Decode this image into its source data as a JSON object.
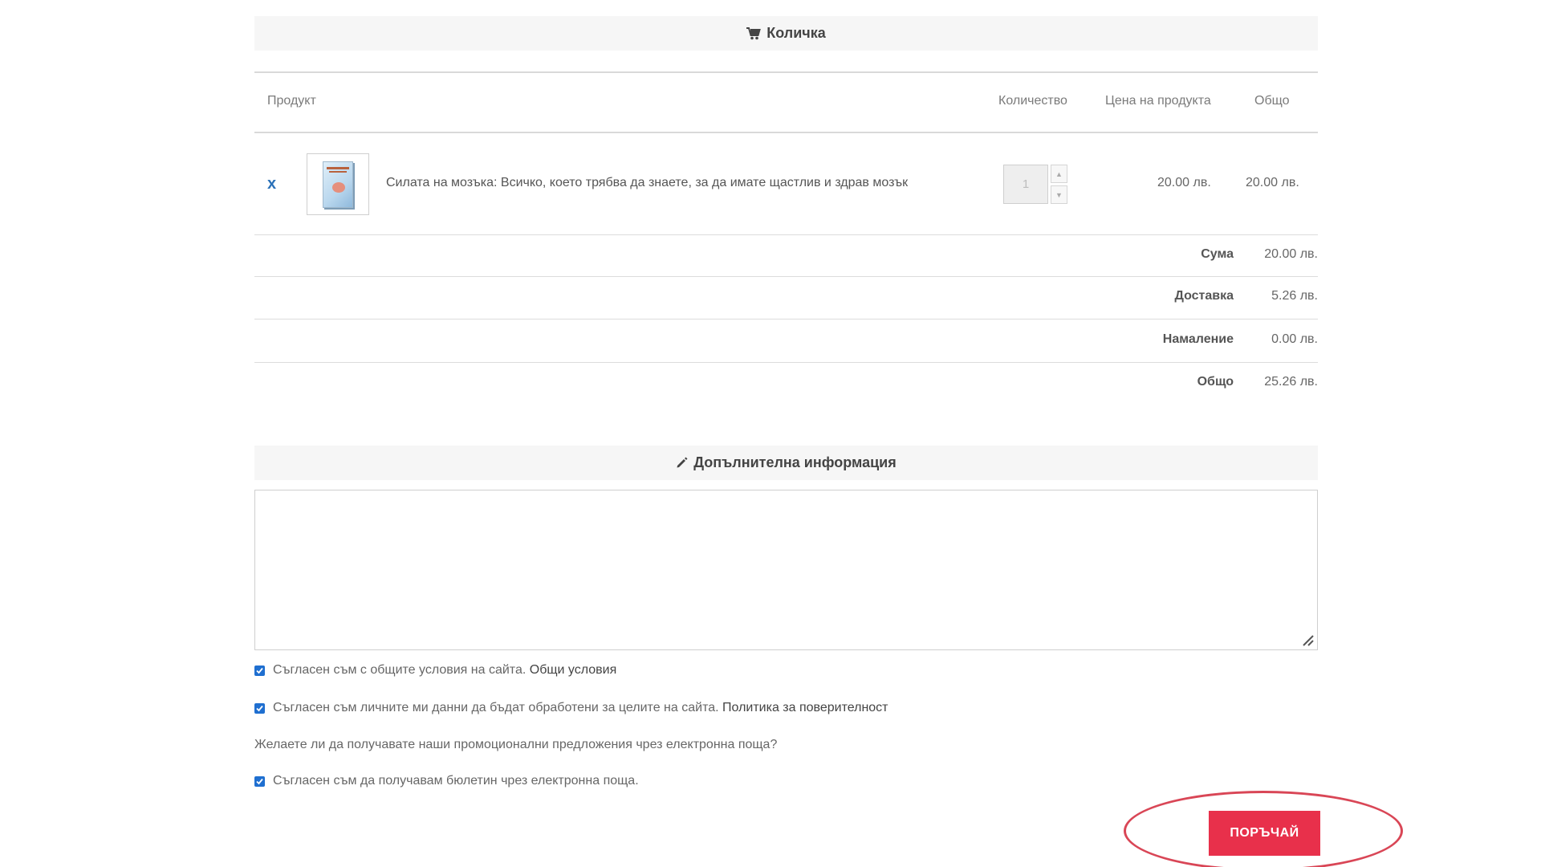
{
  "cart": {
    "title": "Количка",
    "columns": {
      "product": "Продукт",
      "quantity": "Количество",
      "price": "Цена на продукта",
      "total": "Общо"
    },
    "items": [
      {
        "remove_label": "x",
        "name": "Силата на мозъка: Всичко, което трябва да знаете, за да имате щастлив и здрав мозък",
        "quantity": "1",
        "price": "20.00 лв.",
        "total": "20.00 лв."
      }
    ],
    "summary": {
      "subtotal_label": "Сума",
      "subtotal_value": "20.00 лв.",
      "shipping_label": "Доставка",
      "shipping_value": "5.26 лв.",
      "discount_label": "Намаление",
      "discount_value": "0.00 лв.",
      "total_label": "Общо",
      "total_value": "25.26 лв."
    }
  },
  "additional_info": {
    "title": "Допълнителна информация",
    "notes_value": ""
  },
  "consents": {
    "terms_text": "Съгласен съм с общите условия на сайта.",
    "terms_link": "Общи условия",
    "terms_checked": true,
    "privacy_text": "Съгласен съм личните ми данни да бъдат обработени за целите на сайта.",
    "privacy_link": "Политика за поверителност",
    "privacy_checked": true,
    "newsletter_question": "Желаете ли да получавате наши промоционални предложения чрез електронна поща?",
    "newsletter_text": "Съгласен съм да получавам бюлетин чрез електронна поща.",
    "newsletter_checked": true
  },
  "order_button": {
    "label": "ПОРЪЧАЙ"
  },
  "colors": {
    "accent": "#e8304b",
    "link": "#2b71b8",
    "checkbox": "#1f6fd0",
    "highlight": "#d94656"
  },
  "icons": {
    "cart": "cart-icon",
    "edit": "pencil-icon",
    "remove": "close-icon",
    "spin_up": "chevron-up-icon",
    "spin_down": "chevron-down-icon",
    "check": "check-icon"
  }
}
